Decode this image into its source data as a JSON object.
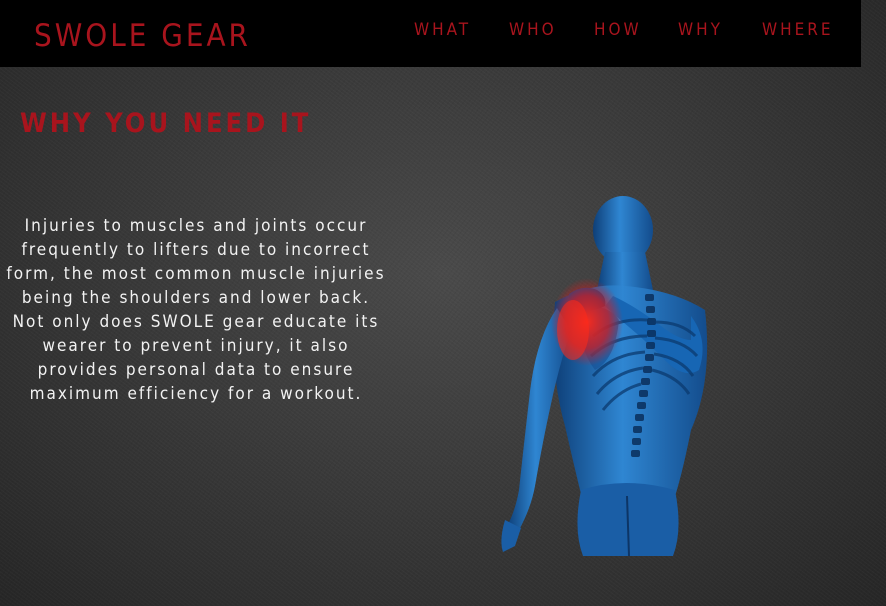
{
  "header": {
    "brand": "SWOLE GEAR",
    "nav": [
      "WHAT",
      "WHO",
      "HOW",
      "WHY",
      "WHERE"
    ]
  },
  "section": {
    "title": "WHY YOU NEED IT",
    "body": "Injuries to muscles and joints occur frequently to lifters due to incorrect form, the most common muscle injuries being the shoulders and lower back. Not only does SWOLE gear educate its wearer to prevent injury, it also provides personal data to ensure maximum efficiency for a workout.",
    "illustration": "shoulder-injury-anatomy-figure"
  },
  "colors": {
    "accent": "#a8141d",
    "header_bg": "#000000",
    "body_bg": "#3a3a3a",
    "text": "#f2f2f2",
    "figure_blue": "#1f6fb8",
    "injury_red": "#e01818"
  }
}
